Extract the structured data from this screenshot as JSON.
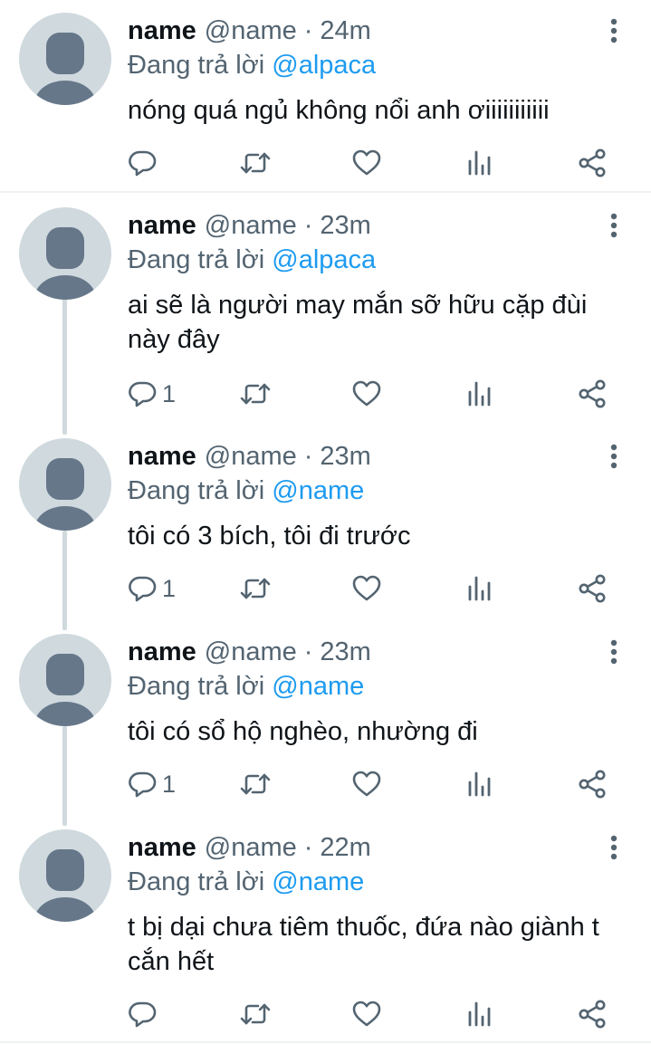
{
  "colors": {
    "accent": "#1d9bf0",
    "secondary_text": "#536471",
    "primary_text": "#0f1419",
    "avatar_bg": "#cfd9de",
    "avatar_fg": "#66778a"
  },
  "tweets": [
    {
      "display_name": "name",
      "handle": "@name",
      "separator": "·",
      "time": "24m",
      "reply_prefix": "Đang trả lời",
      "reply_to": "@alpaca",
      "text": "nóng quá ngủ không nổi anh ơiiiiiiiiiii",
      "reply_count": "",
      "icons": {
        "more": "more-vertical-icon",
        "reply": "reply-icon",
        "retweet": "retweet-icon",
        "like": "heart-icon",
        "views": "views-icon",
        "share": "share-icon"
      }
    },
    {
      "display_name": "name",
      "handle": "@name",
      "separator": "·",
      "time": "23m",
      "reply_prefix": "Đang trả lời",
      "reply_to": "@alpaca",
      "text": "ai sẽ là người may mắn sỡ hữu cặp đùi này đây",
      "reply_count": "1"
    },
    {
      "display_name": "name",
      "handle": "@name",
      "separator": "·",
      "time": "23m",
      "reply_prefix": "Đang trả lời",
      "reply_to": "@name",
      "text": "tôi có 3 bích, tôi đi trước",
      "reply_count": "1"
    },
    {
      "display_name": "name",
      "handle": "@name",
      "separator": "·",
      "time": "23m",
      "reply_prefix": "Đang trả lời",
      "reply_to": "@name",
      "text": "tôi có sổ hộ nghèo, nhường đi",
      "reply_count": "1"
    },
    {
      "display_name": "name",
      "handle": "@name",
      "separator": "·",
      "time": "22m",
      "reply_prefix": "Đang trả lời",
      "reply_to": "@name",
      "text": "t bị dại chưa tiêm thuốc, đứa nào giành t cắn hết",
      "reply_count": ""
    }
  ]
}
